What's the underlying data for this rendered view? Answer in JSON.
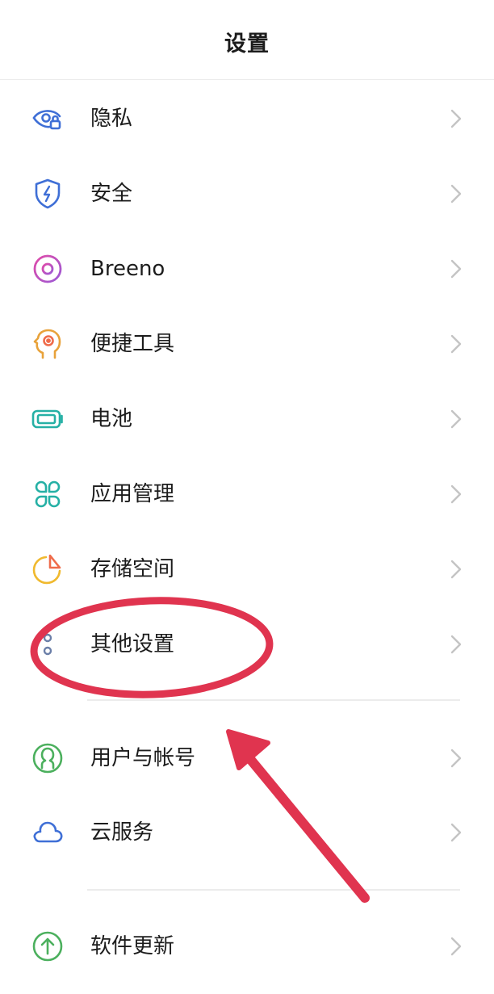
{
  "header": {
    "title": "设置"
  },
  "items": [
    {
      "label": "隐私",
      "icon": "privacy-eye-lock-icon"
    },
    {
      "label": "安全",
      "icon": "security-shield-icon"
    },
    {
      "label": "Breeno",
      "icon": "breeno-circle-icon"
    },
    {
      "label": "便捷工具",
      "icon": "convenience-tools-head-icon"
    },
    {
      "label": "电池",
      "icon": "battery-icon"
    },
    {
      "label": "应用管理",
      "icon": "app-management-grid-icon"
    },
    {
      "label": "存储空间",
      "icon": "storage-pie-icon"
    },
    {
      "label": "其他设置",
      "icon": "more-settings-dots-icon"
    },
    {
      "label": "用户与帐号",
      "icon": "user-account-icon"
    },
    {
      "label": "云服务",
      "icon": "cloud-icon"
    },
    {
      "label": "软件更新",
      "icon": "software-update-arrow-icon"
    }
  ],
  "colors": {
    "privacy": "#3f6fd6",
    "security": "#3f6fd6",
    "breeno_a": "#e04aa8",
    "breeno_b": "#9b59d6",
    "tools": "#e8a23a",
    "battery": "#25b0a5",
    "apps": "#25b0a5",
    "storage_ring": "#f0b92e",
    "storage_slice": "#ef6b4a",
    "more": "#6b7fa8",
    "user": "#4cb05e",
    "cloud": "#3f6fd6",
    "update": "#4cb05e",
    "annotation": "#e0344f",
    "chevron": "#c4c4c4"
  }
}
